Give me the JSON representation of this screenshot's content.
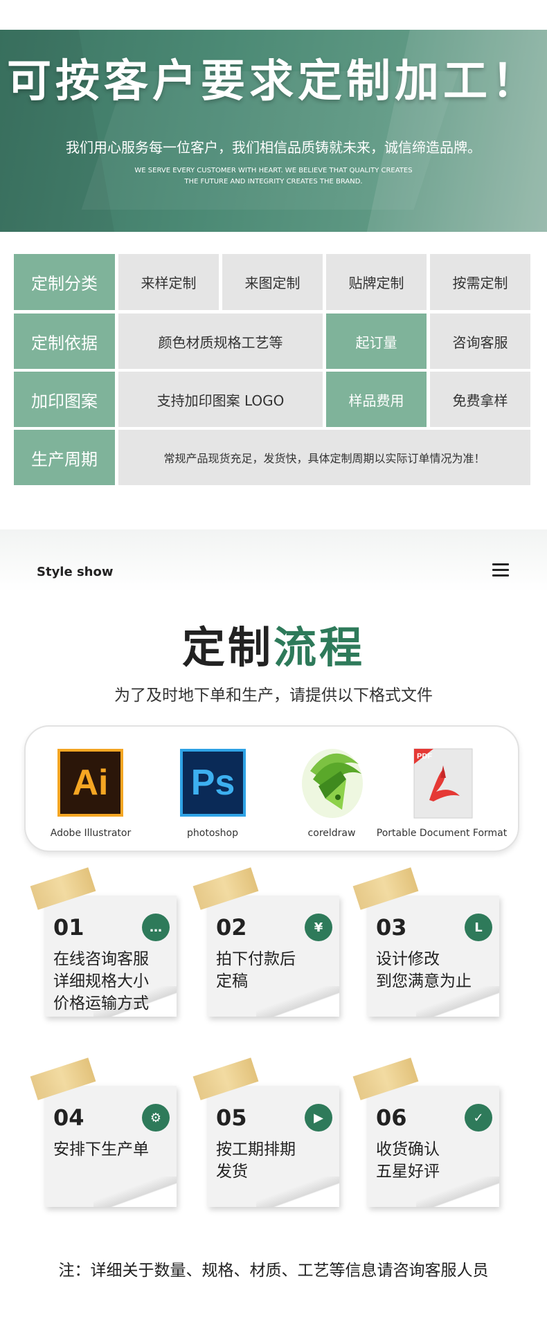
{
  "banner": {
    "title": "可按客户要求定制加工！",
    "subtitle": "我们用心服务每一位客户，我们相信品质铸就未来，诚信缔造品牌。",
    "en_line1": "WE SERVE EVERY CUSTOMER WITH HEART. WE BELIEVE THAT QUALITY CREATES",
    "en_line2": "THE FUTURE AND INTEGRITY CREATES THE BRAND."
  },
  "table": {
    "row1": {
      "label": "定制分类",
      "c1": "来样定制",
      "c2": "来图定制",
      "c3": "贴牌定制",
      "c4": "按需定制"
    },
    "row2": {
      "label": "定制依据",
      "c1": "颜色材质规格工艺等",
      "c2": "起订量",
      "c3": "咨询客服"
    },
    "row3": {
      "label": "加印图案",
      "c1": "支持加印图案 LOGO",
      "c2": "样品费用",
      "c3": "免费拿样"
    },
    "row4": {
      "label": "生产周期",
      "c1": "常规产品现货充足，发货快，具体定制周期以实际订单情况为准！"
    }
  },
  "style_show": {
    "title": "Style show"
  },
  "process": {
    "title_dark": "定制",
    "title_green": "流程",
    "subtitle": "为了及时地下单和生产，请提供以下格式文件"
  },
  "software": [
    {
      "icon": "adobe-illustrator-icon",
      "logo_text": "Ai",
      "label": "Adobe Illustrator"
    },
    {
      "icon": "photoshop-icon",
      "logo_text": "Ps",
      "label": "photoshop"
    },
    {
      "icon": "coreldraw-icon",
      "label": "coreldraw"
    },
    {
      "icon": "pdf-icon",
      "logo_text": "PDF",
      "label": "Portable Document Format"
    }
  ],
  "steps": [
    {
      "num": "01",
      "icon": "chat-icon",
      "glyph": "…",
      "line1": "在线咨询客服",
      "line2": "详细规格大小",
      "line3": "价格运输方式"
    },
    {
      "num": "02",
      "icon": "yen-icon",
      "glyph": "¥",
      "line1": "拍下付款后",
      "line2": "定稿",
      "line3": ""
    },
    {
      "num": "03",
      "icon": "ruler-icon",
      "glyph": "L",
      "line1": "设计修改",
      "line2": "到您满意为止",
      "line3": ""
    },
    {
      "num": "04",
      "icon": "gear-icon",
      "glyph": "⚙",
      "line1": "安排下生产单",
      "line2": "",
      "line3": ""
    },
    {
      "num": "05",
      "icon": "truck-icon",
      "glyph": "▶",
      "line1": "按工期排期",
      "line2": "发货",
      "line3": ""
    },
    {
      "num": "06",
      "icon": "check-icon",
      "glyph": "✓",
      "line1": "收货确认",
      "line2": "五星好评",
      "line3": ""
    }
  ],
  "colors": {
    "green": "#2e7a5a",
    "table_green": "#7fb39a",
    "table_gray": "#e5e5e5"
  },
  "footnote": "注：详细关于数量、规格、材质、工艺等信息请咨询客服人员"
}
